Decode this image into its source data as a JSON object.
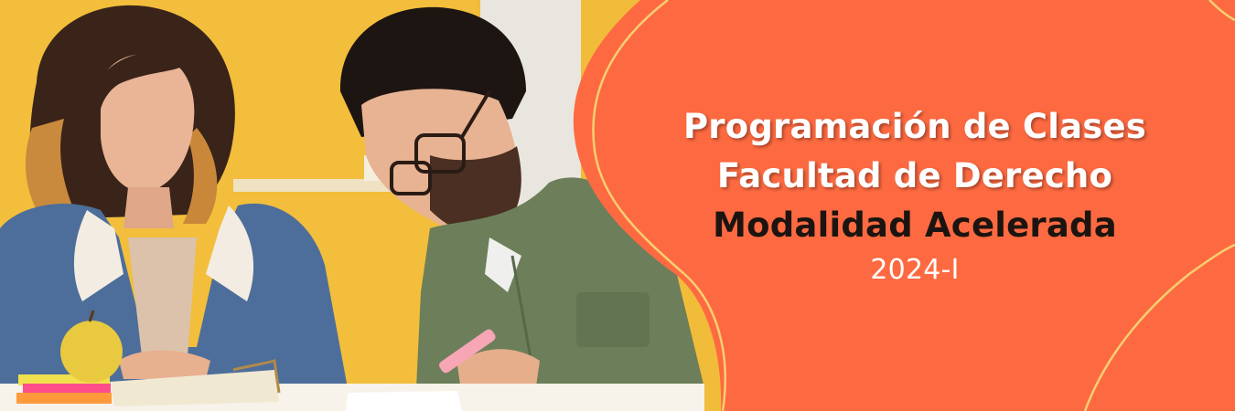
{
  "banner": {
    "title_line1": "Programación de Clases",
    "title_line2": "Facultad de Derecho",
    "title_line3": "Modalidad Acelerada",
    "period": "2024-I"
  },
  "colors": {
    "panel": "#FD6A41",
    "accent_line": "#F6CF72",
    "wall": "#F1BC3A",
    "dark_text": "#1C1410"
  }
}
